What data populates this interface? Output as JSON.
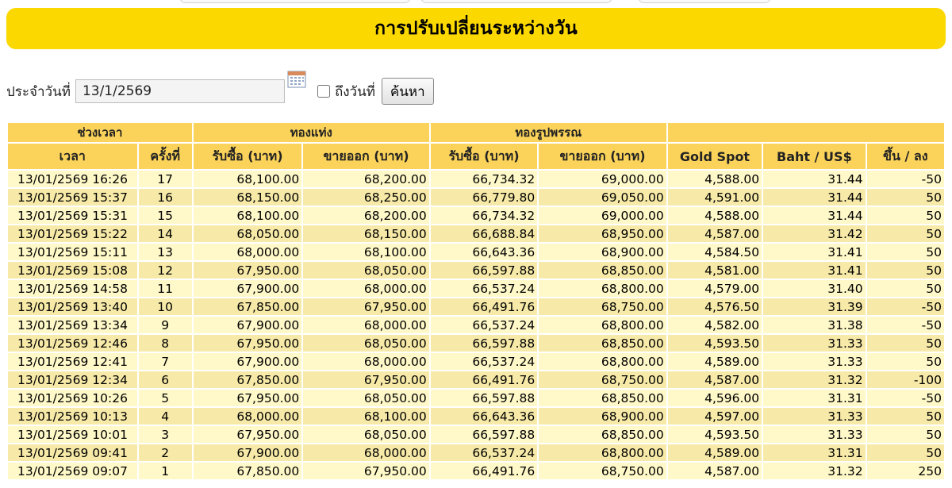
{
  "header": {
    "title": "การปรับเปลี่ยนระหว่างวัน"
  },
  "search": {
    "date_label": "ประจำวันที่",
    "date_value": "13/1/2569",
    "to_date_label": "ถึงวันที่",
    "search_button": "ค้นหา"
  },
  "table": {
    "group_headers": {
      "period": "ช่วงเวลา",
      "bar_gold": "ทองแท่ง",
      "ornament_gold": "ทองรูปพรรณ"
    },
    "columns": {
      "time": "เวลา",
      "round": "ครั้งที่",
      "bar_buy": "รับซื้อ (บาท)",
      "bar_sell": "ขายออก (บาท)",
      "orn_buy": "รับซื้อ (บาท)",
      "orn_sell": "ขายออก (บาท)",
      "gold_spot": "Gold Spot",
      "baht_usd": "Baht / US$",
      "change": "ขึ้น / ลง"
    },
    "rows": [
      {
        "time": "13/01/2569 16:26",
        "round": "17",
        "bar_buy": "68,100.00",
        "bar_sell": "68,200.00",
        "orn_buy": "66,734.32",
        "orn_sell": "69,000.00",
        "gold_spot": "4,588.00",
        "baht_usd": "31.44",
        "change": "-50"
      },
      {
        "time": "13/01/2569 15:37",
        "round": "16",
        "bar_buy": "68,150.00",
        "bar_sell": "68,250.00",
        "orn_buy": "66,779.80",
        "orn_sell": "69,050.00",
        "gold_spot": "4,591.00",
        "baht_usd": "31.44",
        "change": "50"
      },
      {
        "time": "13/01/2569 15:31",
        "round": "15",
        "bar_buy": "68,100.00",
        "bar_sell": "68,200.00",
        "orn_buy": "66,734.32",
        "orn_sell": "69,000.00",
        "gold_spot": "4,588.00",
        "baht_usd": "31.44",
        "change": "50"
      },
      {
        "time": "13/01/2569 15:22",
        "round": "14",
        "bar_buy": "68,050.00",
        "bar_sell": "68,150.00",
        "orn_buy": "66,688.84",
        "orn_sell": "68,950.00",
        "gold_spot": "4,587.00",
        "baht_usd": "31.42",
        "change": "50"
      },
      {
        "time": "13/01/2569 15:11",
        "round": "13",
        "bar_buy": "68,000.00",
        "bar_sell": "68,100.00",
        "orn_buy": "66,643.36",
        "orn_sell": "68,900.00",
        "gold_spot": "4,584.50",
        "baht_usd": "31.41",
        "change": "50"
      },
      {
        "time": "13/01/2569 15:08",
        "round": "12",
        "bar_buy": "67,950.00",
        "bar_sell": "68,050.00",
        "orn_buy": "66,597.88",
        "orn_sell": "68,850.00",
        "gold_spot": "4,581.00",
        "baht_usd": "31.41",
        "change": "50"
      },
      {
        "time": "13/01/2569 14:58",
        "round": "11",
        "bar_buy": "67,900.00",
        "bar_sell": "68,000.00",
        "orn_buy": "66,537.24",
        "orn_sell": "68,800.00",
        "gold_spot": "4,579.00",
        "baht_usd": "31.40",
        "change": "50"
      },
      {
        "time": "13/01/2569 13:40",
        "round": "10",
        "bar_buy": "67,850.00",
        "bar_sell": "67,950.00",
        "orn_buy": "66,491.76",
        "orn_sell": "68,750.00",
        "gold_spot": "4,576.50",
        "baht_usd": "31.39",
        "change": "-50"
      },
      {
        "time": "13/01/2569 13:34",
        "round": "9",
        "bar_buy": "67,900.00",
        "bar_sell": "68,000.00",
        "orn_buy": "66,537.24",
        "orn_sell": "68,800.00",
        "gold_spot": "4,582.00",
        "baht_usd": "31.38",
        "change": "-50"
      },
      {
        "time": "13/01/2569 12:46",
        "round": "8",
        "bar_buy": "67,950.00",
        "bar_sell": "68,050.00",
        "orn_buy": "66,597.88",
        "orn_sell": "68,850.00",
        "gold_spot": "4,593.50",
        "baht_usd": "31.33",
        "change": "50"
      },
      {
        "time": "13/01/2569 12:41",
        "round": "7",
        "bar_buy": "67,900.00",
        "bar_sell": "68,000.00",
        "orn_buy": "66,537.24",
        "orn_sell": "68,800.00",
        "gold_spot": "4,589.00",
        "baht_usd": "31.33",
        "change": "50"
      },
      {
        "time": "13/01/2569 12:34",
        "round": "6",
        "bar_buy": "67,850.00",
        "bar_sell": "67,950.00",
        "orn_buy": "66,491.76",
        "orn_sell": "68,750.00",
        "gold_spot": "4,587.00",
        "baht_usd": "31.32",
        "change": "-100"
      },
      {
        "time": "13/01/2569 10:26",
        "round": "5",
        "bar_buy": "67,950.00",
        "bar_sell": "68,050.00",
        "orn_buy": "66,597.88",
        "orn_sell": "68,850.00",
        "gold_spot": "4,596.00",
        "baht_usd": "31.31",
        "change": "-50"
      },
      {
        "time": "13/01/2569 10:13",
        "round": "4",
        "bar_buy": "68,000.00",
        "bar_sell": "68,100.00",
        "orn_buy": "66,643.36",
        "orn_sell": "68,900.00",
        "gold_spot": "4,597.00",
        "baht_usd": "31.33",
        "change": "50"
      },
      {
        "time": "13/01/2569 10:01",
        "round": "3",
        "bar_buy": "67,950.00",
        "bar_sell": "68,050.00",
        "orn_buy": "66,597.88",
        "orn_sell": "68,850.00",
        "gold_spot": "4,593.50",
        "baht_usd": "31.33",
        "change": "50"
      },
      {
        "time": "13/01/2569 09:41",
        "round": "2",
        "bar_buy": "67,900.00",
        "bar_sell": "68,000.00",
        "orn_buy": "66,537.24",
        "orn_sell": "68,800.00",
        "gold_spot": "4,589.00",
        "baht_usd": "31.31",
        "change": "50"
      },
      {
        "time": "13/01/2569 09:07",
        "round": "1",
        "bar_buy": "67,850.00",
        "bar_sell": "67,950.00",
        "orn_buy": "66,491.76",
        "orn_sell": "68,750.00",
        "gold_spot": "4,587.00",
        "baht_usd": "31.32",
        "change": "250"
      }
    ]
  },
  "colors": {
    "header_bar": "#fbd800",
    "table_header": "#fbd35a",
    "row_light": "#fff8c8",
    "row_dark": "#f7eaa8"
  }
}
